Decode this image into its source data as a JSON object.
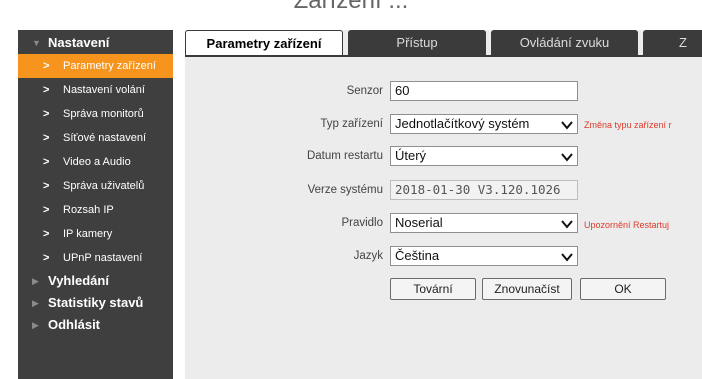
{
  "caption": "Zařízení ...",
  "sidebar": {
    "sections": [
      {
        "label": "Nastavení"
      },
      {
        "label": "Vyhledání"
      },
      {
        "label": "Statistiky stavů"
      },
      {
        "label": "Odhlásit"
      }
    ],
    "items": [
      {
        "label": "Parametry zařízení"
      },
      {
        "label": "Nastavení volání"
      },
      {
        "label": "Správa monitorů"
      },
      {
        "label": "Síťové nastavení"
      },
      {
        "label": "Video a Audio"
      },
      {
        "label": "Správa uživatelů"
      },
      {
        "label": "Rozsah IP"
      },
      {
        "label": "IP kamery"
      },
      {
        "label": "UPnP nastavení"
      }
    ]
  },
  "tabs": [
    {
      "label": "Parametry zařízení"
    },
    {
      "label": "Přístup"
    },
    {
      "label": "Ovládání zvuku"
    },
    {
      "label": "Z"
    }
  ],
  "form": {
    "sensor": {
      "label": "Senzor",
      "value": "60"
    },
    "device_type": {
      "label": "Typ zařízení",
      "value": "Jednotlačítkový systém",
      "note": "Změna typu zařízení r"
    },
    "restart_date": {
      "label": "Datum restartu",
      "value": "Úterý"
    },
    "system_version": {
      "label": "Verze systému",
      "value": "2018-01-30 V3.120.1026"
    },
    "rule": {
      "label": "Pravidlo",
      "value": "Noserial",
      "note": "Upozornění Restartuj"
    },
    "language": {
      "label": "Jazyk",
      "value": "Čeština"
    }
  },
  "buttons": {
    "factory": "Tovární",
    "reload": "Znovunačíst",
    "ok": "OK"
  },
  "colors": {
    "sidebar_bg": "#3f3f3f",
    "active_item": "#f7941d",
    "main_bg": "#ececec",
    "note": "#e03a2a"
  }
}
